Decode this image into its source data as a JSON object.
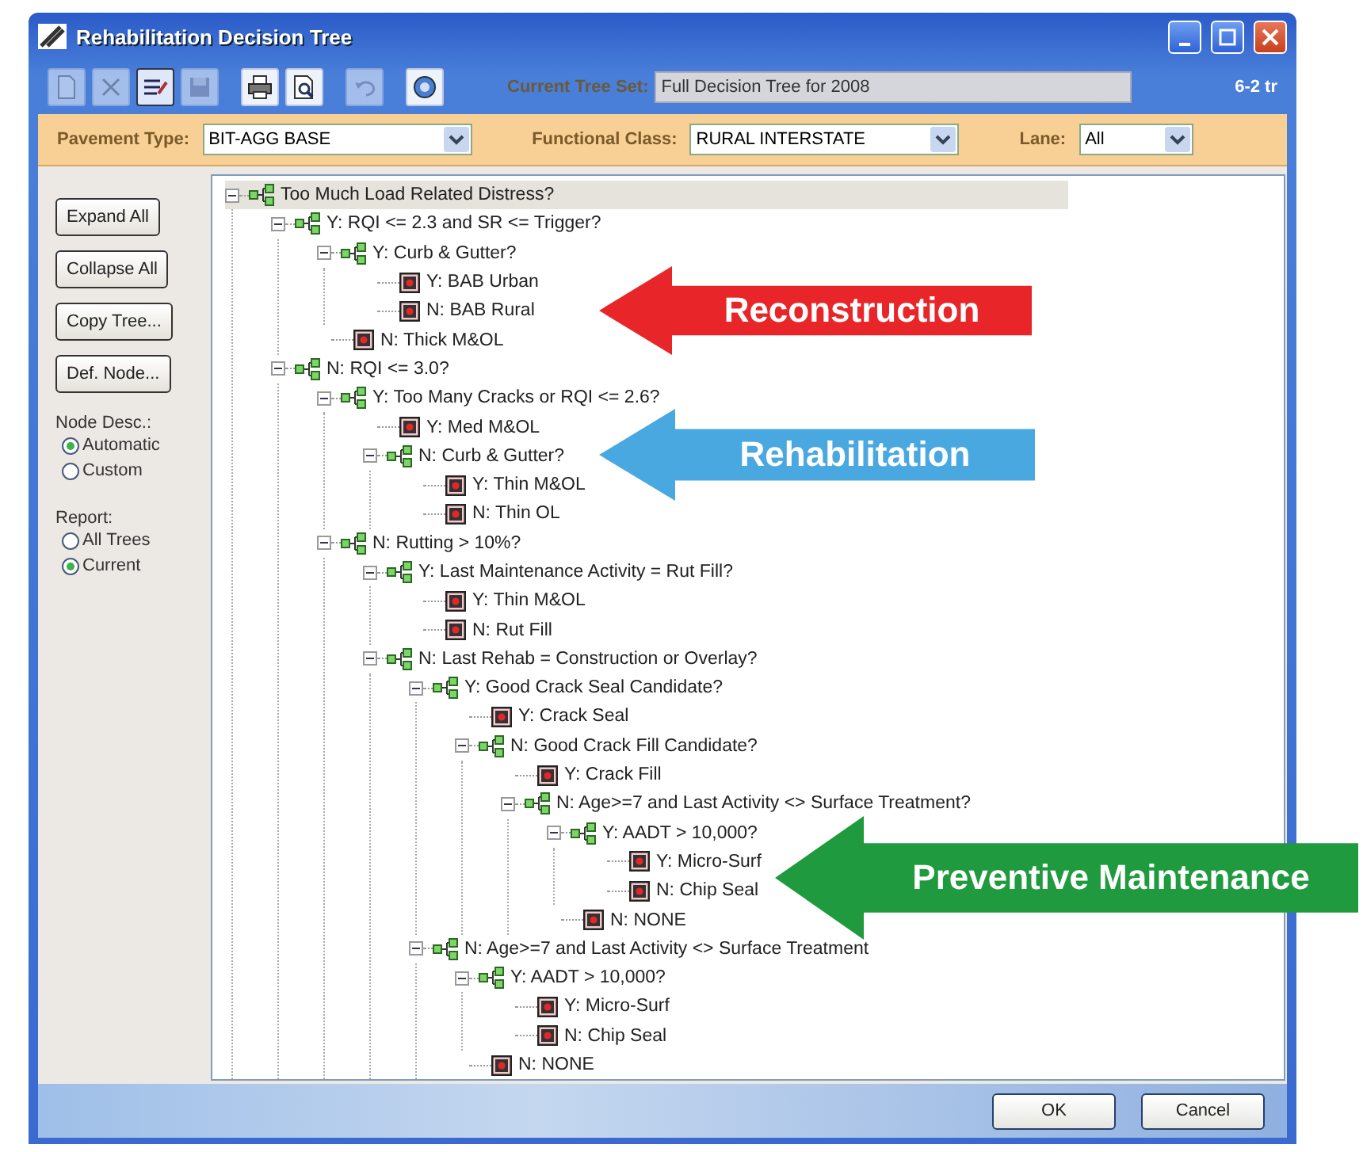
{
  "window": {
    "title": "Rehabilitation Decision Tree",
    "corner_text": "6-2 tr"
  },
  "toolbar": {
    "buttons": [
      {
        "kind": "new",
        "disabled": true,
        "pressed": false
      },
      {
        "kind": "delete",
        "disabled": true,
        "pressed": false
      },
      {
        "kind": "edit",
        "disabled": false,
        "pressed": true
      },
      {
        "kind": "save",
        "disabled": true,
        "pressed": false
      },
      {
        "kind": "print",
        "disabled": false,
        "pressed": false
      },
      {
        "kind": "preview",
        "disabled": false,
        "pressed": false
      },
      {
        "kind": "undo",
        "disabled": true,
        "pressed": false
      },
      {
        "kind": "help",
        "disabled": false,
        "pressed": false
      }
    ],
    "tree_set_label": "Current Tree Set:",
    "tree_set_value": "Full Decision Tree for 2008"
  },
  "filters": [
    {
      "label": "Pavement Type:",
      "value": "BIT-AGG BASE"
    },
    {
      "label": "Functional Class:",
      "value": "RURAL INTERSTATE"
    },
    {
      "label": "Lane:",
      "value": "All"
    }
  ],
  "side_panel": {
    "buttons": [
      "Expand All",
      "Collapse All",
      "Copy Tree...",
      "Def. Node..."
    ],
    "groups": [
      {
        "label": "Node Desc.:",
        "options": [
          {
            "label": "Automatic",
            "selected": true
          },
          {
            "label": "Custom",
            "selected": false
          }
        ]
      },
      {
        "label": "Report:",
        "options": [
          {
            "label": "All Trees",
            "selected": false
          },
          {
            "label": "Current",
            "selected": true
          }
        ]
      }
    ]
  },
  "tree": {
    "label": "Too Much Load Related Distress?",
    "kind": "decision",
    "selected": true,
    "expanded": true,
    "children": [
      {
        "label": "Y: RQI <= 2.3 and SR <= Trigger?",
        "kind": "decision",
        "selected": false,
        "expanded": true,
        "children": [
          {
            "label": "Y: Curb & Gutter?",
            "kind": "decision",
            "selected": false,
            "expanded": true,
            "children": [
              {
                "label": "Y: BAB Urban",
                "kind": "treatment",
                "selected": false
              },
              {
                "label": "N: BAB Rural",
                "kind": "treatment",
                "selected": false
              }
            ]
          },
          {
            "label": "N: Thick M&OL",
            "kind": "treatment",
            "selected": false
          }
        ]
      },
      {
        "label": "N: RQI <= 3.0?",
        "kind": "decision",
        "selected": false,
        "expanded": true,
        "children": [
          {
            "label": "Y: Too Many Cracks or RQI <= 2.6?",
            "kind": "decision",
            "selected": false,
            "expanded": true,
            "children": [
              {
                "label": "Y: Med M&OL",
                "kind": "treatment",
                "selected": false
              },
              {
                "label": "N: Curb & Gutter?",
                "kind": "decision",
                "selected": false,
                "expanded": true,
                "children": [
                  {
                    "label": "Y: Thin M&OL",
                    "kind": "treatment",
                    "selected": false
                  },
                  {
                    "label": "N: Thin OL",
                    "kind": "treatment",
                    "selected": false
                  }
                ]
              }
            ]
          },
          {
            "label": "N: Rutting > 10%?",
            "kind": "decision",
            "selected": false,
            "expanded": true,
            "children": [
              {
                "label": "Y: Last Maintenance Activity = Rut Fill?",
                "kind": "decision",
                "selected": false,
                "expanded": true,
                "children": [
                  {
                    "label": "Y: Thin M&OL",
                    "kind": "treatment",
                    "selected": false
                  },
                  {
                    "label": "N: Rut Fill",
                    "kind": "treatment",
                    "selected": false
                  }
                ]
              },
              {
                "label": "N: Last Rehab = Construction or Overlay?",
                "kind": "decision",
                "selected": false,
                "expanded": true,
                "children": [
                  {
                    "label": "Y: Good Crack Seal Candidate?",
                    "kind": "decision",
                    "selected": false,
                    "expanded": true,
                    "children": [
                      {
                        "label": "Y: Crack Seal",
                        "kind": "treatment",
                        "selected": false
                      },
                      {
                        "label": "N: Good Crack Fill Candidate?",
                        "kind": "decision",
                        "selected": false,
                        "expanded": true,
                        "children": [
                          {
                            "label": "Y: Crack Fill",
                            "kind": "treatment",
                            "selected": false
                          },
                          {
                            "label": "N: Age>=7 and Last Activity <> Surface Treatment?",
                            "kind": "decision",
                            "selected": false,
                            "expanded": true,
                            "children": [
                              {
                                "label": "Y: AADT > 10,000?",
                                "kind": "decision",
                                "selected": false,
                                "expanded": true,
                                "children": [
                                  {
                                    "label": "Y: Micro-Surf",
                                    "kind": "treatment",
                                    "selected": false
                                  },
                                  {
                                    "label": "N: Chip Seal",
                                    "kind": "treatment",
                                    "selected": false
                                  }
                                ]
                              },
                              {
                                "label": "N: NONE",
                                "kind": "treatment",
                                "selected": false
                              }
                            ]
                          }
                        ]
                      }
                    ]
                  },
                  {
                    "label": "N: Age>=7 and Last Activity <> Surface Treatment",
                    "kind": "decision",
                    "selected": false,
                    "expanded": true,
                    "children": [
                      {
                        "label": "Y: AADT > 10,000?",
                        "kind": "decision",
                        "selected": false,
                        "expanded": true,
                        "children": [
                          {
                            "label": "Y: Micro-Surf",
                            "kind": "treatment",
                            "selected": false
                          },
                          {
                            "label": "N: Chip Seal",
                            "kind": "treatment",
                            "selected": false
                          }
                        ]
                      },
                      {
                        "label": "N: NONE",
                        "kind": "treatment",
                        "selected": false
                      }
                    ]
                  }
                ]
              }
            ]
          }
        ]
      }
    ]
  },
  "footer_buttons": [
    "OK",
    "Cancel"
  ],
  "callouts": [
    {
      "text": "Reconstruction",
      "color": "#e8262a"
    },
    {
      "text": "Rehabilitation",
      "color": "#4aa8e0"
    },
    {
      "text": "Preventive Maintenance",
      "color": "#1f9a3e"
    }
  ]
}
